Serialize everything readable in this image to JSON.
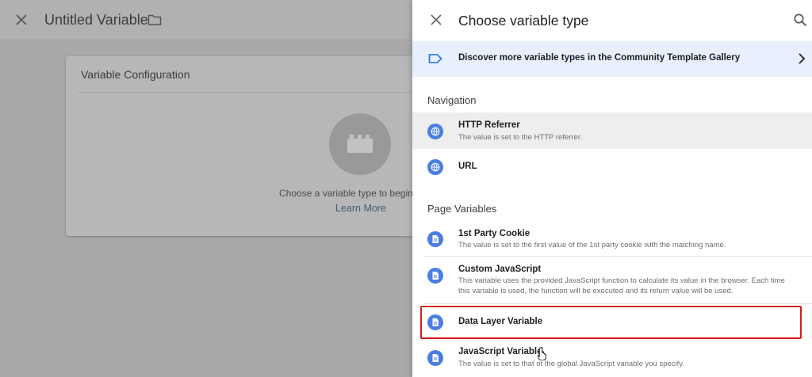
{
  "editor": {
    "title": "Untitled Variable",
    "card_title": "Variable Configuration",
    "prompt": "Choose a variable type to begin .",
    "learn_more": "Learn More"
  },
  "panel": {
    "title": "Choose variable type",
    "gallery_text": "Discover more variable types in the Community Template Gallery",
    "sections": [
      {
        "heading": "Navigation",
        "items": [
          {
            "name": "HTTP Referrer",
            "desc": "The value is set to the HTTP referrer."
          },
          {
            "name": "URL",
            "desc": ""
          }
        ]
      },
      {
        "heading": "Page Variables",
        "items": [
          {
            "name": "1st Party Cookie",
            "desc": "The value is set to the first value of the 1st party cookie with the matching name."
          },
          {
            "name": "Custom JavaScript",
            "desc": "This variable uses the provided JavaScript function to calculate its value in the browser. Each time this variable is used, the function will be executed and its return value will be used."
          },
          {
            "name": "Data Layer Variable",
            "desc": ""
          },
          {
            "name": "JavaScript Variable",
            "desc": "The value is set to that of the global JavaScript variable you specify."
          }
        ]
      }
    ]
  },
  "colors": {
    "accent": "#4a7fe0",
    "highlight_box": "#d41f1f",
    "gallery_bg": "#e8f0fe"
  }
}
